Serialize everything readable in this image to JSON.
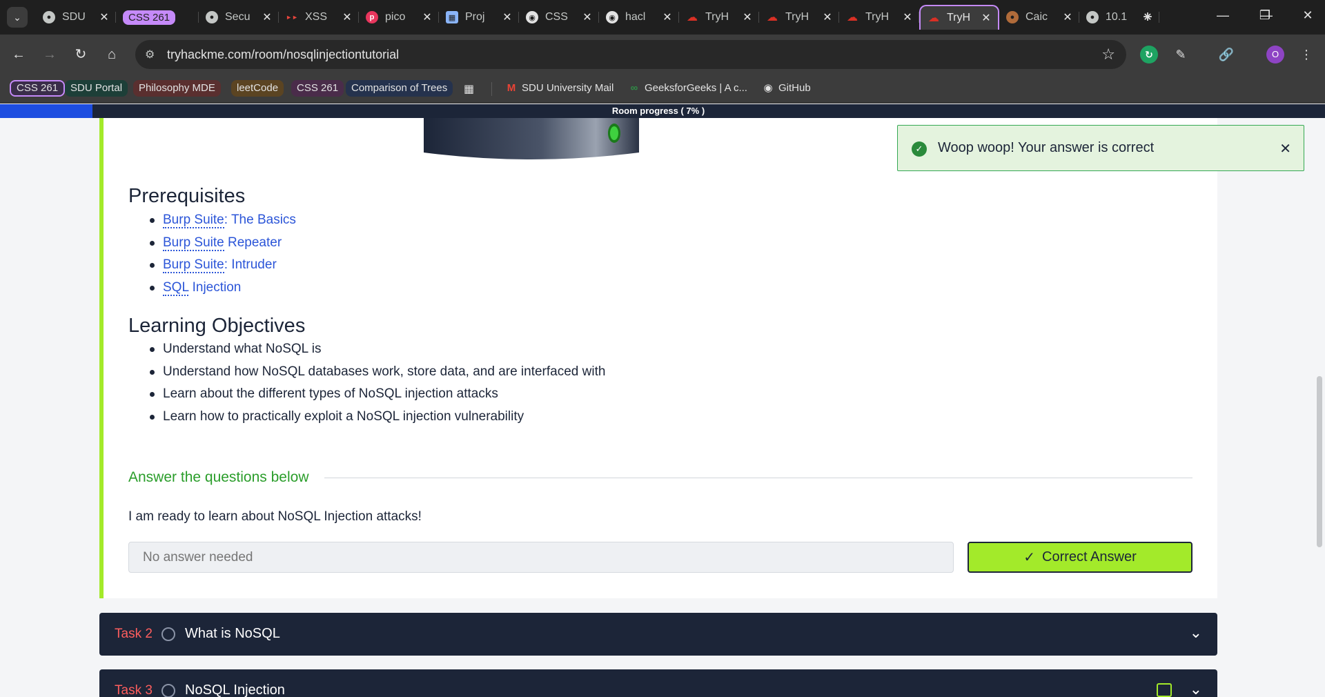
{
  "browser": {
    "tabs": [
      {
        "label": "SDU",
        "favicon": "globe-icon",
        "color": "#c4c7c5"
      },
      {
        "label": "CSS 261",
        "favicon": "tab-group-label",
        "color": "#c58af9"
      },
      {
        "label": "Secu",
        "favicon": "globe-icon",
        "color": "#c4c7c5"
      },
      {
        "label": "XSS",
        "favicon": "hackersploit-icon",
        "color": "#e8453c"
      },
      {
        "label": "pico",
        "favicon": "picoctf-icon",
        "color": "#e8365d"
      },
      {
        "label": "Proj",
        "favicon": "project-board-icon",
        "color": "#8ab4f8"
      },
      {
        "label": "CSS",
        "favicon": "github-icon",
        "color": "#e3e3e3"
      },
      {
        "label": "hacl",
        "favicon": "github-icon",
        "color": "#e3e3e3"
      },
      {
        "label": "TryH",
        "favicon": "tryhackme-cloud-icon",
        "color": "#d93025"
      },
      {
        "label": "TryH",
        "favicon": "tryhackme-cloud-icon",
        "color": "#d93025"
      },
      {
        "label": "TryH",
        "favicon": "tryhackme-cloud-icon",
        "color": "#d93025"
      },
      {
        "label": "TryH",
        "favicon": "tryhackme-cloud-icon",
        "color": "#d93025",
        "active": true
      },
      {
        "label": "Caic",
        "favicon": "cookie-icon",
        "color": "#b06b3a"
      },
      {
        "label": "10.1",
        "favicon": "globe-icon",
        "color": "#c4c7c5"
      }
    ],
    "address": "tryhackme.com/room/nosqlinjectiontutorial",
    "profile_initial": "O",
    "bookmarks": {
      "group1": "CSS 261",
      "group2": "SDU Portal",
      "group3": "Philosophy MDE",
      "group4": "leetCode",
      "group5": "CSS 261",
      "group6": "Comparison of Trees",
      "link1": "SDU University Mail",
      "link2": "GeeksforGeeks | A c...",
      "link3": "GitHub"
    }
  },
  "room": {
    "progress_label": "Room progress ( 7% )",
    "progress_value": 7,
    "prerequisites_heading": "Prerequisites",
    "prerequisites": [
      {
        "abbr": "Burp Suite",
        "rest": ": The Basics"
      },
      {
        "abbr": "Burp Suite",
        "rest": " Repeater"
      },
      {
        "abbr": "Burp Suite",
        "rest": ": Intruder"
      },
      {
        "abbr": "SQL",
        "rest": " Injection"
      }
    ],
    "objectives_heading": "Learning Objectives",
    "objectives": [
      "Understand what NoSQL is",
      "Understand how NoSQL databases work, store data, and are interfaced with",
      "Learn about the different types of NoSQL injection attacks",
      "Learn how to practically exploit a NoSQL injection vulnerability"
    ],
    "answers_heading": "Answer the questions below",
    "question": "I am ready to learn about NoSQL Injection attacks!",
    "answer_placeholder": "No answer needed",
    "submit_label": "Correct Answer",
    "tasks": [
      {
        "number": "Task 2",
        "title": "What is NoSQL"
      },
      {
        "number": "Task 3",
        "title": "NoSQL Injection"
      }
    ]
  },
  "toast": {
    "message": "Woop woop! Your answer is correct"
  },
  "colors": {
    "accent_green": "#a3ea2a",
    "navy": "#1c2538",
    "link_blue": "#2b55d8",
    "task_red": "#ff5e5e",
    "progress_blue": "#1d4de0"
  }
}
